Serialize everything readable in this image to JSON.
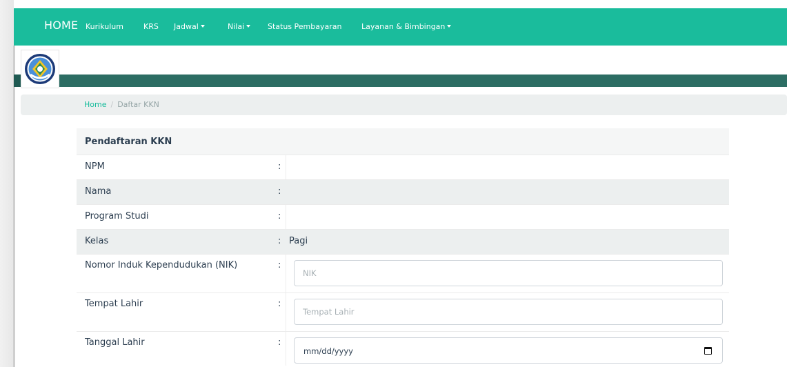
{
  "nav": {
    "brand": "HOME",
    "items": [
      {
        "label": "Kurikulum"
      },
      {
        "label": "KRS"
      },
      {
        "label": "Jadwal"
      },
      {
        "label": "Nilai"
      },
      {
        "label": "Status Pembayaran"
      },
      {
        "label": "Layanan & Bimbingan"
      }
    ]
  },
  "breadcrumb": {
    "home": "Home",
    "separator": "/",
    "current": "Daftar KKN"
  },
  "form": {
    "title": "Pendaftaran KKN",
    "rows": [
      {
        "label": "NPM",
        "value": ""
      },
      {
        "label": "Nama",
        "value": ""
      },
      {
        "label": "Program Studi",
        "value": ""
      },
      {
        "label": "Kelas",
        "value": "Pagi"
      },
      {
        "label": "Nomor Induk Kependudukan (NIK)",
        "placeholder": "NIK"
      },
      {
        "label": "Tempat Lahir",
        "placeholder": "Tempat Lahir"
      },
      {
        "label": "Tanggal Lahir",
        "date_format": "mm/dd/yyyy"
      }
    ],
    "colon": ":"
  },
  "colors": {
    "navbar": "#1abc9c",
    "header_strip": "#2c6d63",
    "link": "#18bc9c",
    "stripe": "#ecefef"
  },
  "icons": {
    "logo": "university-seal-logo",
    "date": "calendar-icon"
  }
}
